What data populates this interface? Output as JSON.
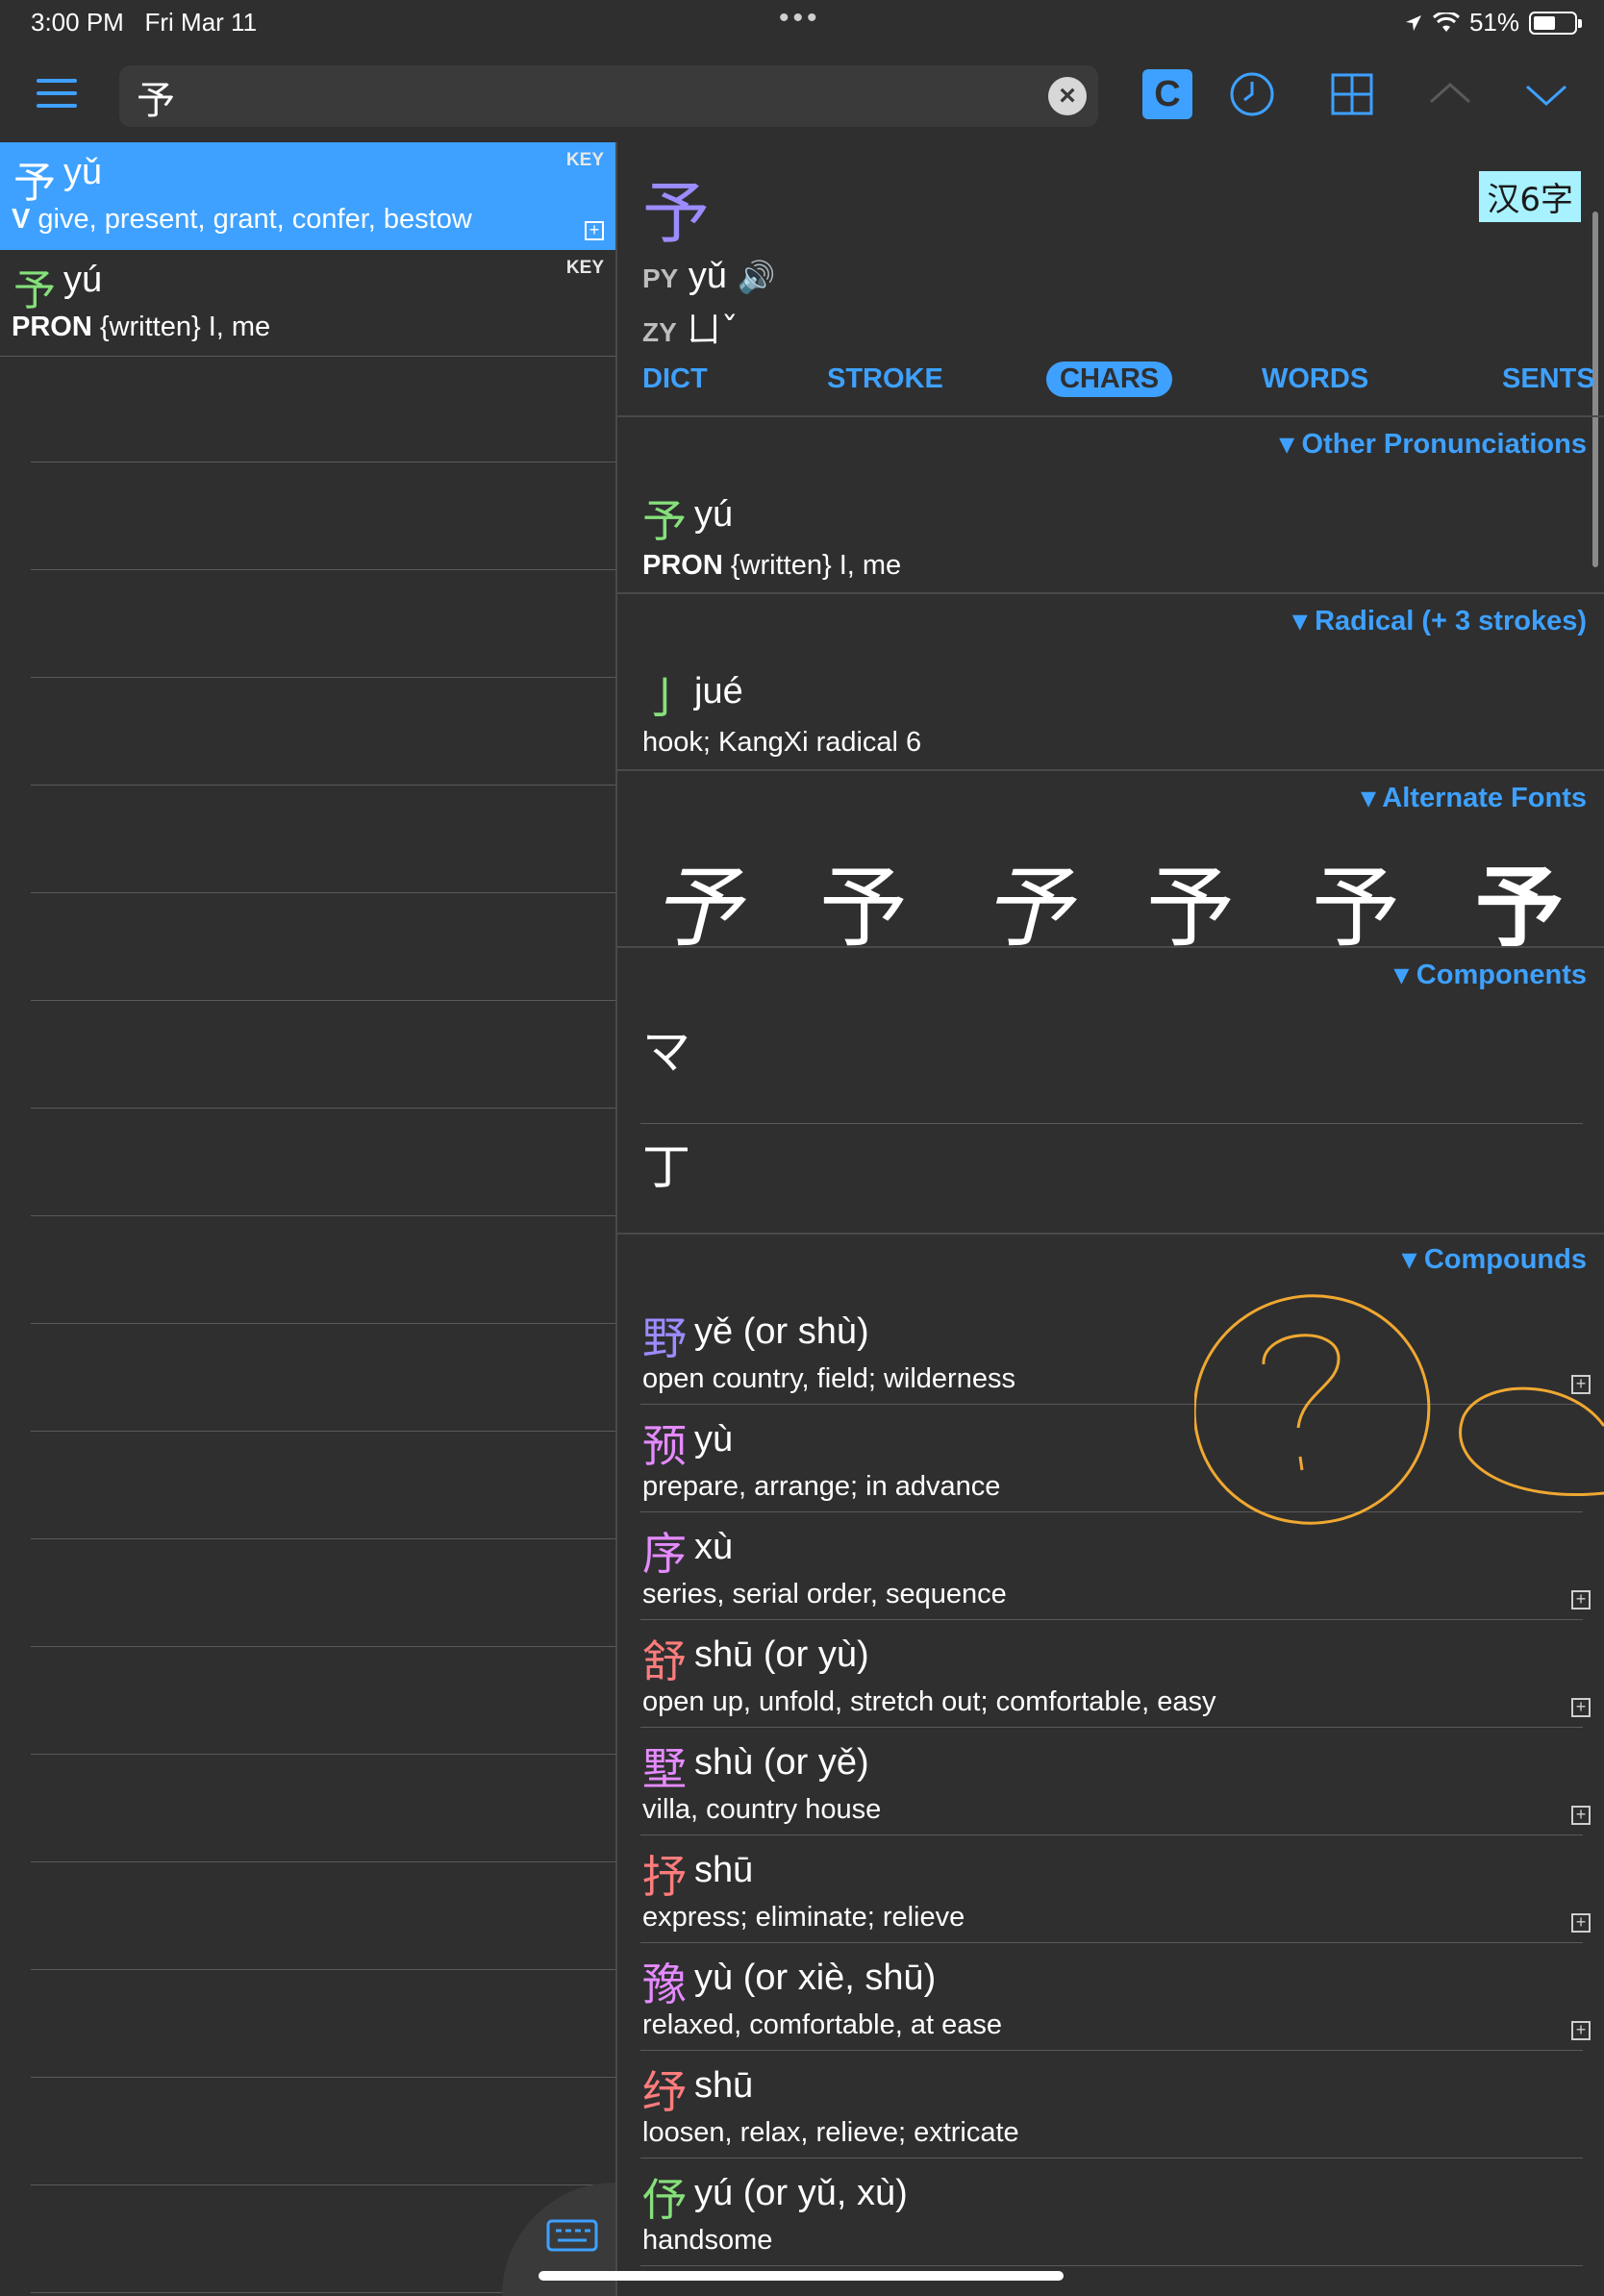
{
  "status": {
    "time": "3:00 PM",
    "date": "Fri Mar 11",
    "dots": "•••",
    "battery": "51%",
    "location_icon": "location-arrow-icon",
    "wifi_icon": "wifi-icon"
  },
  "toolbar": {
    "search_value": "予",
    "c_label": "C",
    "clear_label": "×",
    "accent": "#3ea1ff"
  },
  "results": [
    {
      "hanzi": "予",
      "pinyin": "yǔ",
      "tag": "KEY",
      "pos": "V",
      "def": "give, present, grant, confer, bestow",
      "plus": "+"
    },
    {
      "hanzi": "予",
      "pinyin": "yú",
      "tag": "KEY",
      "pos": "PRON",
      "def": "{written} I, me"
    }
  ],
  "detail": {
    "hanzi": "予",
    "hsk_badge": "汉6字",
    "py_label": "PY",
    "py": "yǔ",
    "speaker": "🔊",
    "zy_label": "ZY",
    "zy": "ㄩˇ",
    "tabs": [
      "DICT",
      "STROKE",
      "CHARS",
      "WORDS",
      "SENTS"
    ],
    "active_tab": "CHARS",
    "sections": {
      "other_pron": {
        "title": "▾ Other Pronunciations",
        "hanzi": "予",
        "pinyin": "yú",
        "pos": "PRON",
        "def": "{written} I, me"
      },
      "radical": {
        "title": "▾ Radical (+ 3 strokes)",
        "hanzi": "亅",
        "pinyin": "jué",
        "def": "hook; KangXi radical 6"
      },
      "alt_fonts": {
        "title": "▾ Alternate Fonts",
        "glyphs": [
          "予",
          "予",
          "予",
          "予",
          "予",
          "予"
        ]
      },
      "components": {
        "title": "▾ Components",
        "items": [
          "マ",
          "丁"
        ]
      },
      "compounds": {
        "title": "▾ Compounds",
        "items": [
          {
            "hanzi": "野",
            "pinyin": "yě (or shù)",
            "def": "open country, field; wilderness",
            "color": "#9b8cff",
            "plus": "+"
          },
          {
            "hanzi": "预",
            "pinyin": "yù",
            "def": "prepare, arrange; in advance",
            "color": "#e58bff"
          },
          {
            "hanzi": "序",
            "pinyin": "xù",
            "def": "series, serial order, sequence",
            "color": "#e58bff",
            "plus": "+"
          },
          {
            "hanzi": "舒",
            "pinyin": "shū (or yù)",
            "def": "open up, unfold, stretch out; comfortable, easy",
            "color": "#ff7c7c",
            "plus": "+"
          },
          {
            "hanzi": "墅",
            "pinyin": "shù (or yě)",
            "def": "villa, country house",
            "color": "#e58bff",
            "plus": "+"
          },
          {
            "hanzi": "抒",
            "pinyin": "shū",
            "def": "express; eliminate; relieve",
            "color": "#ff7c7c",
            "plus": "+"
          },
          {
            "hanzi": "豫",
            "pinyin": "yù (or xiè, shū)",
            "def": "relaxed, comfortable, at ease",
            "color": "#e58bff",
            "plus": "+"
          },
          {
            "hanzi": "纾",
            "pinyin": "shū",
            "def": "loosen, relax, relieve; extricate",
            "color": "#ff7c7c"
          },
          {
            "hanzi": "伃",
            "pinyin": "yú (or yǔ, xù)",
            "def": "handsome",
            "color": "#86e07a"
          }
        ]
      }
    }
  },
  "annotation_color": "#f0a830"
}
